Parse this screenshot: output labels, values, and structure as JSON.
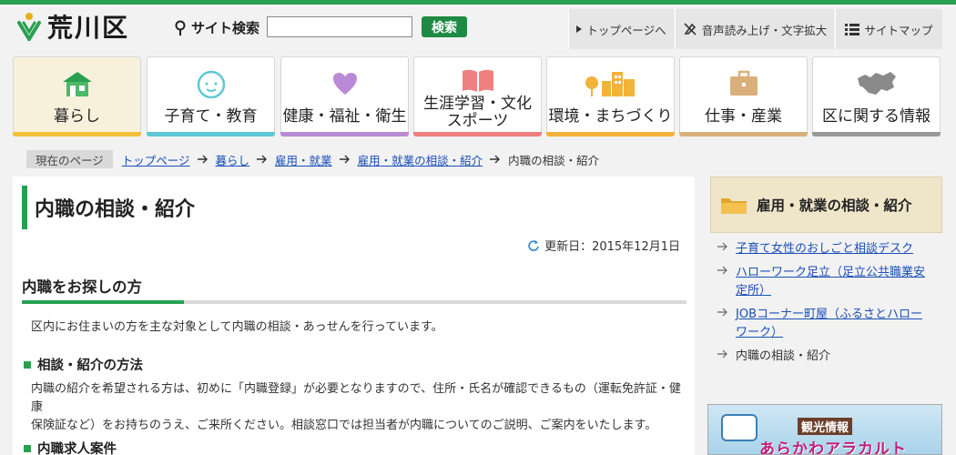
{
  "header": {
    "site_name": "荒川区",
    "search_label": "サイト検索",
    "search_value": "",
    "search_button": "検索",
    "util_top": "トップページへ",
    "util_voice": "音声読み上げ・文字拡大",
    "util_sitemap": "サイトマップ"
  },
  "nav": [
    {
      "label": "暮らし",
      "color": "#f0c23a"
    },
    {
      "label": "子育て・教育",
      "color": "#5ec8d4"
    },
    {
      "label": "健康・福祉・衛生",
      "color": "#b98bd6"
    },
    {
      "label": "生涯学習・文化スポーツ",
      "label1": "生涯学習・文化",
      "label2": "スポーツ",
      "color": "#f08080"
    },
    {
      "label": "環境・まちづくり",
      "color": "#f3b23a"
    },
    {
      "label": "仕事・産業",
      "color": "#d9b07a"
    },
    {
      "label": "区に関する情報",
      "color": "#999999"
    }
  ],
  "breadcrumb": {
    "current_label": "現在のページ",
    "items": [
      "トップページ",
      "暮らし",
      "雇用・就業",
      "雇用・就業の相談・紹介"
    ],
    "last": "内職の相談・紹介"
  },
  "main": {
    "title": "内職の相談・紹介",
    "updated": "更新日：2015年12月1日",
    "h2": "内職をお探しの方",
    "intro": "区内にお住まいの方を主な対象として内職の相談・あっせんを行っています。",
    "h3_method": "相談・紹介の方法",
    "method_text_1": "内職の紹介を希望される方は、初めに「内職登録」が必要となりますので、住所・氏名が確認できるもの（運転免許証・健康",
    "method_text_2": "保険証など）をお持ちのうえ、ご来所ください。相談窓口では担当者が内職についてのご説明、ご案内をいたします。",
    "h3_jobs": "内職求人案件"
  },
  "side": {
    "title": "雇用・就業の相談・紹介",
    "items": [
      {
        "text1": "子育て女性のおしごと相談デスク"
      },
      {
        "text1": "ハローワーク足立（足立公共職業安",
        "text2": "定所）"
      },
      {
        "text1": "JOBコーナー町屋（ふるさとハロー",
        "text2": "ワーク）"
      },
      {
        "text1": "内職の相談・紹介"
      }
    ]
  },
  "banner": {
    "sub": "観光情報",
    "main": "あらかわアラカルト"
  },
  "colors": {
    "brand_green": "#27a050",
    "link": "#1a4fb8"
  }
}
